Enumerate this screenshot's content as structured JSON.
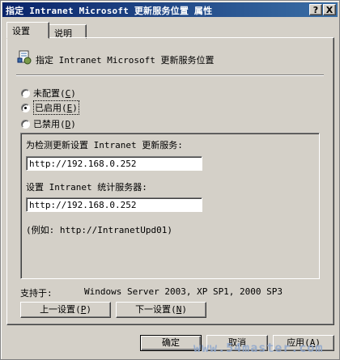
{
  "window": {
    "title": "指定 Intranet Microsoft 更新服务位置 属性",
    "help_btn": "?",
    "close_btn": "X"
  },
  "tabs": [
    {
      "label": "设置"
    },
    {
      "label": "说明"
    }
  ],
  "setting": {
    "heading": "指定 Intranet Microsoft 更新服务位置",
    "radios": [
      {
        "label": "未配置",
        "key": "C",
        "checked": false
      },
      {
        "label": "已启用",
        "key": "E",
        "checked": true
      },
      {
        "label": "已禁用",
        "key": "D",
        "checked": false
      }
    ]
  },
  "options": {
    "update_label": "为检测更新设置 Intranet 更新服务:",
    "update_value": "http://192.168.0.252",
    "stats_label": "设置 Intranet 统计服务器:",
    "stats_value": "http://192.168.0.252",
    "example": "(例如: http://IntranetUpd01)"
  },
  "supported": {
    "label": "支持于:",
    "value": "Windows Server 2003, XP SP1, 2000 SP3"
  },
  "nav": {
    "prev": "上一设置",
    "prev_key": "P",
    "next": "下一设置",
    "next_key": "N"
  },
  "footer": {
    "ok": "确定",
    "cancel": "取消",
    "apply": "应用",
    "apply_key": "A"
  },
  "watermark": "www.54master.com"
}
